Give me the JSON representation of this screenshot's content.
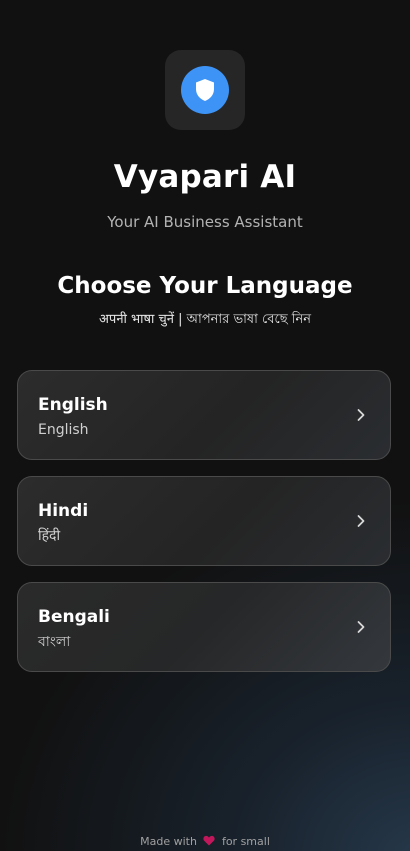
{
  "app": {
    "title": "Vyapari AI",
    "subtitle": "Your AI Business Assistant",
    "logo_icon": "shield-icon",
    "accent_color": "#3d94f6"
  },
  "language_section": {
    "title": "Choose Your Language",
    "subtitle": "अपनी भाषा चुनें | আপনার ভাষা বেছে নিন"
  },
  "languages": [
    {
      "name": "English",
      "native": "English",
      "icon": "chevron-right-icon"
    },
    {
      "name": "Hindi",
      "native": "हिंदी",
      "icon": "chevron-right-icon"
    },
    {
      "name": "Bengali",
      "native": "বাংলা",
      "icon": "chevron-right-icon"
    }
  ],
  "footer": {
    "prefix": "Made with",
    "heart_icon": "heart-icon",
    "heart_color": "#c2185b",
    "suffix": "for small"
  }
}
